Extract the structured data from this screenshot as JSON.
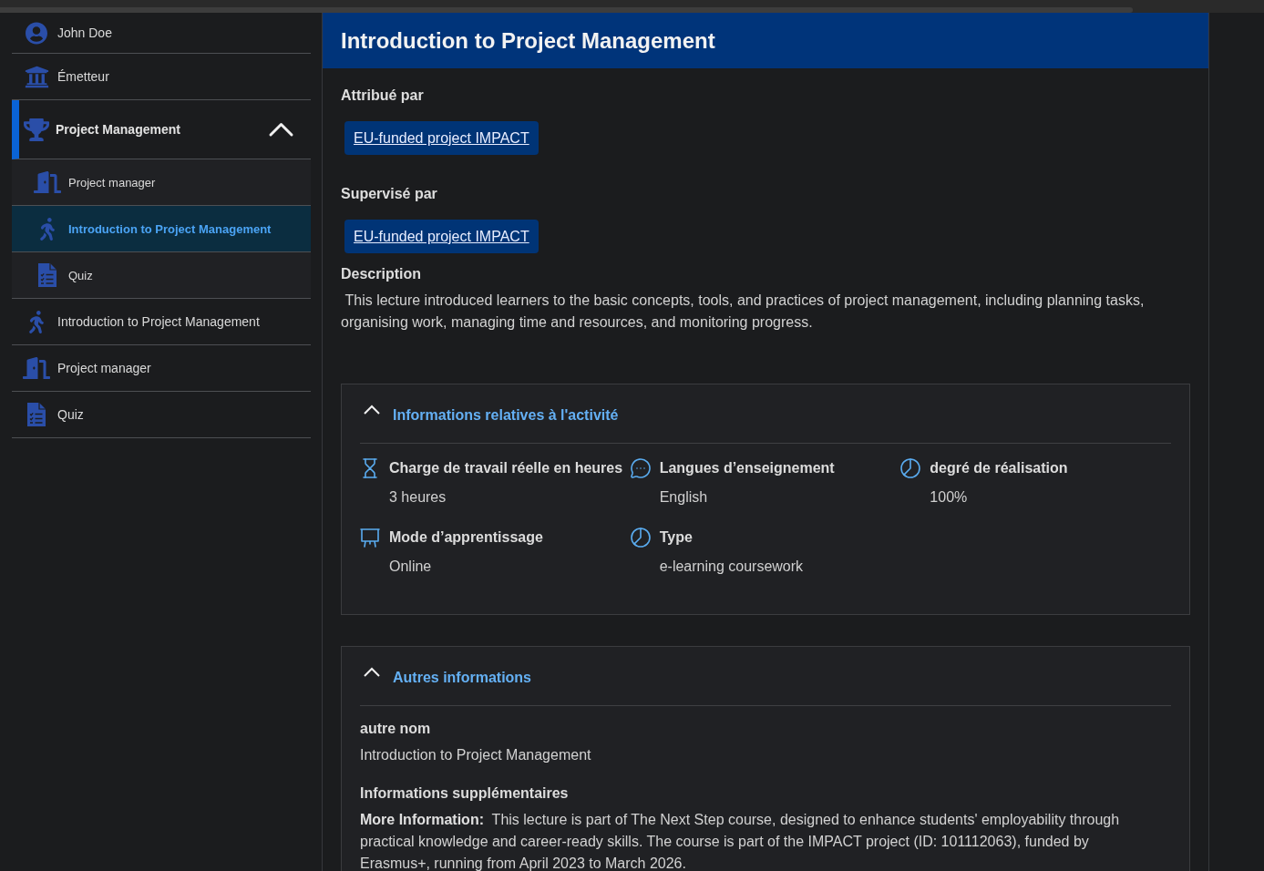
{
  "sidebar": {
    "items": [
      {
        "kind": "user",
        "label": "John Doe",
        "selected": false
      },
      {
        "kind": "issuer",
        "label": "Émetteur",
        "selected": false
      },
      {
        "kind": "course",
        "label": "Project Management",
        "selected": true,
        "expanded": true,
        "children": [
          {
            "kind": "role",
            "label": "Project manager",
            "selected": false
          },
          {
            "kind": "activity",
            "label": "Introduction to Project Management",
            "selected": true
          },
          {
            "kind": "quiz",
            "label": "Quiz",
            "selected": false
          }
        ]
      },
      {
        "kind": "activity",
        "label": "Introduction to Project Management",
        "selected": false
      },
      {
        "kind": "role",
        "label": "Project manager",
        "selected": false
      },
      {
        "kind": "quiz",
        "label": "Quiz",
        "selected": false
      }
    ]
  },
  "header": {
    "title": "Introduction to Project Management"
  },
  "fields": [
    {
      "label": "Attribué par",
      "link": "EU-funded project IMPACT"
    },
    {
      "label": "Supervisé par",
      "link": "EU-funded project IMPACT"
    }
  ],
  "description": {
    "label": "Description",
    "text": " This lecture introduced learners to the basic concepts, tools, and practices of project management, including planning tasks, organising work, managing time and resources, and monitoring progress."
  },
  "sections": [
    {
      "kind": "facts",
      "title": "Informations relatives à l'activité",
      "expanded": true,
      "facts": [
        {
          "kind": "workload",
          "label": "Charge de travail réelle en heures",
          "value": "3 heures"
        },
        {
          "kind": "language",
          "label": "Langues d’enseignement",
          "value": "English"
        },
        {
          "kind": "progress",
          "label": "degré de réalisation",
          "value": "100%"
        },
        {
          "kind": "mode",
          "label": "Mode d’apprentissage",
          "value": "Online"
        },
        {
          "kind": "type",
          "label": "Type",
          "value": "e-learning coursework"
        }
      ]
    },
    {
      "kind": "details",
      "title": "Autres informations",
      "expanded": true,
      "entries": [
        {
          "label": "autre nom",
          "text": "Introduction to Project Management"
        },
        {
          "label": "Informations supplémentaires",
          "text": "**More Information:**  This lecture is part of The Next Step course, designed to enhance students' employability through practical knowledge and career-ready skills. The course is part of the IMPACT project (ID: 101112063), funded by Erasmus+, running from April 2023 to March 2026."
        }
      ]
    }
  ]
}
